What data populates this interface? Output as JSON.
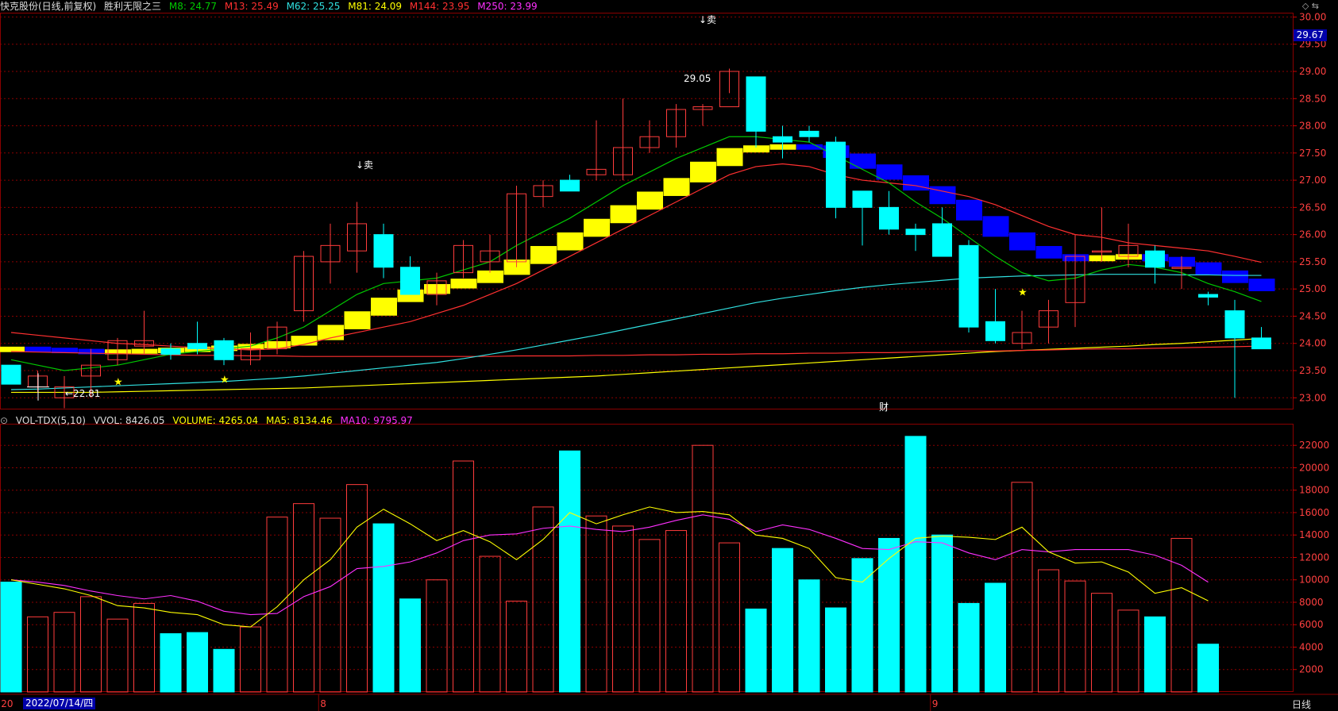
{
  "header": {
    "stock": "快克股份(日线,前复权)",
    "indicator": "胜利无限之三",
    "ma": [
      {
        "label": "M8: 24.77",
        "color": "#00c800"
      },
      {
        "label": "M13: 25.49",
        "color": "#ff3030"
      },
      {
        "label": "M62: 25.25",
        "color": "#30e0e0"
      },
      {
        "label": "M81: 24.09",
        "color": "#ffff00"
      },
      {
        "label": "M144: 23.95",
        "color": "#ff3030"
      },
      {
        "label": "M250: 23.99",
        "color": "#ff30ff"
      }
    ]
  },
  "volume_header": {
    "name": "VOL-TDX(5,10)",
    "vvol": "VVOL: 8426.05",
    "volume": "VOLUME: 4265.04",
    "ma5": "MA5: 8134.46",
    "ma10": "MA10: 9795.97"
  },
  "price_badge": "29.67",
  "date_badge": "2022/07/14/四",
  "period": "日线",
  "annotations": {
    "sell1": "↓卖",
    "sell2": "↓卖",
    "high_label": "29.05",
    "low_label": "←22.81",
    "cai": "财"
  },
  "colors": {
    "up": "#ff3c3c",
    "down": "#00ffff",
    "ma8": "#00c800",
    "ma13": "#ff3030",
    "ma62": "#30e0e0",
    "ma81": "#ffff00",
    "ma144": "#ff3030",
    "vma5": "#ffff00",
    "vma10": "#ff30ff",
    "grid": "#8b0000"
  },
  "chart_data": {
    "type": "candlestick",
    "price_axis": {
      "ylim": [
        22.8,
        30.05
      ],
      "ticks": [
        "30.00",
        "29.50",
        "29.00",
        "28.50",
        "28.00",
        "27.50",
        "27.00",
        "26.50",
        "26.00",
        "25.50",
        "25.00",
        "24.50",
        "24.00",
        "23.50",
        "23.00"
      ]
    },
    "volume_axis": {
      "ylim": [
        0,
        23500
      ],
      "ticks": [
        "22000",
        "20000",
        "18000",
        "16000",
        "14000",
        "12000",
        "10000",
        "8000",
        "6000",
        "4000",
        "2000"
      ]
    },
    "x_labels": [
      {
        "index": 0,
        "text": "20"
      },
      {
        "index": 12,
        "text": "8"
      },
      {
        "index": 35,
        "text": "9"
      }
    ],
    "candles": [
      [
        23.6,
        23.6,
        23.3,
        23.25
      ],
      [
        23.2,
        23.5,
        23.1,
        23.4
      ],
      [
        23.0,
        23.4,
        22.81,
        23.2
      ],
      [
        23.4,
        23.9,
        23.0,
        23.6
      ],
      [
        23.7,
        24.1,
        23.6,
        24.05
      ],
      [
        23.95,
        24.6,
        23.8,
        24.05
      ],
      [
        23.9,
        24.0,
        23.7,
        23.8
      ],
      [
        24.0,
        24.4,
        23.8,
        23.9
      ],
      [
        24.05,
        24.1,
        23.6,
        23.7
      ],
      [
        23.7,
        24.2,
        23.6,
        23.9
      ],
      [
        23.9,
        24.4,
        23.8,
        24.3
      ],
      [
        24.6,
        25.7,
        24.4,
        25.6
      ],
      [
        25.5,
        26.2,
        25.1,
        25.8
      ],
      [
        25.7,
        26.6,
        25.3,
        26.2
      ],
      [
        26.0,
        26.2,
        25.2,
        25.4
      ],
      [
        25.4,
        25.6,
        24.9,
        24.9
      ],
      [
        24.9,
        25.3,
        24.7,
        25.15
      ],
      [
        25.3,
        25.9,
        25.2,
        25.8
      ],
      [
        25.5,
        26.0,
        25.3,
        25.7
      ],
      [
        25.5,
        26.9,
        25.4,
        26.75
      ],
      [
        26.7,
        27.0,
        26.5,
        26.9
      ],
      [
        27.0,
        27.1,
        26.8,
        26.8
      ],
      [
        27.1,
        28.1,
        27.0,
        27.2
      ],
      [
        27.1,
        28.5,
        27.0,
        27.6
      ],
      [
        27.6,
        28.1,
        27.5,
        27.8
      ],
      [
        27.8,
        28.4,
        27.6,
        28.3
      ],
      [
        28.3,
        28.4,
        28.0,
        28.35
      ],
      [
        28.35,
        29.05,
        28.6,
        29.0
      ],
      [
        28.9,
        28.9,
        27.6,
        27.9
      ],
      [
        27.8,
        28.0,
        27.4,
        27.7
      ],
      [
        27.9,
        28.0,
        27.7,
        27.8
      ],
      [
        27.7,
        27.8,
        26.3,
        26.5
      ],
      [
        26.8,
        26.8,
        25.8,
        26.5
      ],
      [
        26.5,
        26.8,
        26.0,
        26.1
      ],
      [
        26.1,
        26.2,
        25.7,
        26.0
      ],
      [
        26.2,
        26.5,
        25.6,
        25.6
      ],
      [
        25.8,
        25.9,
        24.2,
        24.3
      ],
      [
        24.4,
        25.0,
        24.0,
        24.05
      ],
      [
        24.0,
        24.6,
        23.9,
        24.2
      ],
      [
        24.3,
        24.8,
        24.0,
        24.6
      ],
      [
        24.75,
        26.0,
        24.3,
        25.6
      ],
      [
        25.7,
        26.5,
        25.5,
        25.7
      ],
      [
        25.6,
        26.2,
        25.4,
        25.8
      ],
      [
        25.7,
        25.8,
        25.1,
        25.4
      ],
      [
        25.4,
        25.6,
        25.0,
        25.4
      ],
      [
        24.9,
        24.95,
        24.7,
        24.85
      ],
      [
        24.6,
        24.8,
        23.0,
        24.1
      ],
      [
        24.1,
        24.3,
        23.9,
        23.9
      ]
    ],
    "ma8": [
      23.7,
      23.6,
      23.5,
      23.55,
      23.6,
      23.7,
      23.8,
      23.85,
      23.9,
      23.95,
      24.1,
      24.3,
      24.6,
      24.9,
      25.1,
      25.15,
      25.2,
      25.35,
      25.5,
      25.8,
      26.05,
      26.3,
      26.6,
      26.9,
      27.15,
      27.4,
      27.6,
      27.8,
      27.8,
      27.75,
      27.7,
      27.45,
      27.2,
      26.95,
      26.6,
      26.3,
      25.95,
      25.6,
      25.3,
      25.15,
      25.2,
      25.35,
      25.45,
      25.4,
      25.3,
      25.1,
      24.95,
      24.77
    ],
    "ma13": [
      24.2,
      24.15,
      24.1,
      24.05,
      24.0,
      23.98,
      23.95,
      23.92,
      23.9,
      23.88,
      23.9,
      23.98,
      24.1,
      24.2,
      24.3,
      24.4,
      24.55,
      24.7,
      24.9,
      25.1,
      25.35,
      25.6,
      25.85,
      26.1,
      26.35,
      26.6,
      26.85,
      27.1,
      27.25,
      27.3,
      27.25,
      27.1,
      27.0,
      26.95,
      26.9,
      26.8,
      26.7,
      26.55,
      26.35,
      26.15,
      26.0,
      25.95,
      25.85,
      25.8,
      25.75,
      25.7,
      25.6,
      25.49
    ],
    "ma62": [
      23.15,
      23.16,
      23.18,
      23.2,
      23.22,
      23.24,
      23.26,
      23.28,
      23.3,
      23.33,
      23.36,
      23.4,
      23.45,
      23.5,
      23.55,
      23.6,
      23.65,
      23.72,
      23.8,
      23.88,
      23.97,
      24.06,
      24.15,
      24.25,
      24.35,
      24.45,
      24.55,
      24.65,
      24.75,
      24.83,
      24.9,
      24.97,
      25.03,
      25.08,
      25.12,
      25.16,
      25.2,
      25.22,
      25.24,
      25.25,
      25.26,
      25.27,
      25.27,
      25.27,
      25.26,
      25.26,
      25.25,
      25.25
    ],
    "ma81": [
      23.1,
      23.1,
      23.1,
      23.1,
      23.11,
      23.12,
      23.13,
      23.14,
      23.15,
      23.16,
      23.17,
      23.18,
      23.2,
      23.22,
      23.24,
      23.26,
      23.28,
      23.3,
      23.32,
      23.34,
      23.36,
      23.38,
      23.4,
      23.43,
      23.46,
      23.49,
      23.52,
      23.55,
      23.58,
      23.61,
      23.64,
      23.67,
      23.7,
      23.73,
      23.76,
      23.79,
      23.82,
      23.85,
      23.87,
      23.89,
      23.91,
      23.93,
      23.95,
      23.98,
      24.0,
      24.03,
      24.06,
      24.09
    ],
    "ma144": [
      23.85,
      23.84,
      23.83,
      23.82,
      23.81,
      23.8,
      23.79,
      23.78,
      23.78,
      23.77,
      23.77,
      23.76,
      23.76,
      23.76,
      23.76,
      23.76,
      23.76,
      23.76,
      23.76,
      23.77,
      23.77,
      23.77,
      23.78,
      23.78,
      23.79,
      23.79,
      23.8,
      23.8,
      23.81,
      23.81,
      23.82,
      23.82,
      23.83,
      23.83,
      23.84,
      23.85,
      23.86,
      23.86,
      23.87,
      23.88,
      23.89,
      23.9,
      23.9,
      23.91,
      23.92,
      23.93,
      23.94,
      23.95
    ],
    "ribbon": [
      23.9,
      23.88,
      23.86,
      23.84,
      23.85,
      23.86,
      23.88,
      23.9,
      23.92,
      23.95,
      24.0,
      24.1,
      24.3,
      24.55,
      24.8,
      24.95,
      25.05,
      25.15,
      25.3,
      25.5,
      25.75,
      26.0,
      26.25,
      26.5,
      26.75,
      27.0,
      27.3,
      27.55,
      27.6,
      27.62,
      27.6,
      27.45,
      27.25,
      27.05,
      26.85,
      26.6,
      26.3,
      26.0,
      25.75,
      25.6,
      25.55,
      25.58,
      25.6,
      25.55,
      25.45,
      25.3,
      25.15,
      25.0
    ],
    "volumes": [
      9800,
      6700,
      7100,
      8500,
      6500,
      7900,
      5200,
      5300,
      3800,
      5800,
      15600,
      16800,
      15500,
      18500,
      15000,
      8300,
      10000,
      20600,
      12100,
      8100,
      16500,
      21500,
      15700,
      14800,
      13600,
      14400,
      22000,
      13300,
      7400,
      12800,
      10000,
      7500,
      11900,
      13700,
      22800,
      14000,
      7900,
      9700,
      18700,
      10900,
      9900,
      8800,
      7300,
      6700,
      13700,
      4265
    ],
    "vma5": [
      10000,
      9600,
      9200,
      8600,
      7700,
      7500,
      7100,
      6900,
      6000,
      5800,
      7600,
      10000,
      11800,
      14700,
      16300,
      15000,
      13500,
      14400,
      13400,
      11800,
      13600,
      16000,
      15000,
      15800,
      16500,
      16000,
      16100,
      15800,
      14000,
      13700,
      12800,
      10200,
      9800,
      11900,
      13700,
      13900,
      13800,
      13600,
      14700,
      12500,
      11500,
      11600,
      10700,
      8800,
      9300,
      8134
    ],
    "vma10": [
      10000,
      9800,
      9500,
      9000,
      8600,
      8300,
      8600,
      8100,
      7200,
      6900,
      7000,
      8500,
      9400,
      11000,
      11200,
      11600,
      12400,
      13500,
      14000,
      14100,
      14600,
      14800,
      14500,
      14300,
      14700,
      15300,
      15800,
      15400,
      14300,
      14900,
      14500,
      13700,
      12800,
      12700,
      13400,
      13300,
      12400,
      11800,
      12700,
      12500,
      12700,
      12700,
      12700,
      12200,
      11300,
      9796
    ]
  }
}
